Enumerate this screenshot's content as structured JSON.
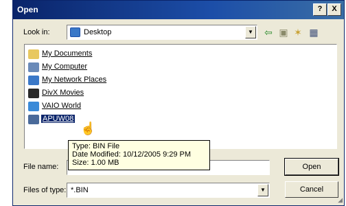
{
  "window": {
    "title": "Open",
    "help_label": "?",
    "close_label": "X"
  },
  "lookin": {
    "label": "Look in:",
    "value": "Desktop"
  },
  "files": [
    {
      "label": "My Documents",
      "icon": "folder-icon",
      "color": "#e8c860"
    },
    {
      "label": "My Computer",
      "icon": "computer-icon",
      "color": "#6a8ab8"
    },
    {
      "label": "My Network Places",
      "icon": "network-icon",
      "color": "#3a78c8"
    },
    {
      "label": "DivX Movies",
      "icon": "divx-icon",
      "color": "#2a2a2a"
    },
    {
      "label": "VAIO World",
      "icon": "vaio-icon",
      "color": "#3a8ad8"
    },
    {
      "label": "APUW08",
      "icon": "bin-file-icon",
      "color": "#4a6a9a"
    }
  ],
  "tooltip": {
    "type": "Type: BIN File",
    "date": "Date Modified: 10/12/2005 9:29 PM",
    "size": "Size: 1.00 MB"
  },
  "filename": {
    "label": "File name:",
    "value": ""
  },
  "filetype": {
    "label": "Files of type:",
    "value": "*.BIN"
  },
  "buttons": {
    "open": "Open",
    "cancel": "Cancel"
  }
}
